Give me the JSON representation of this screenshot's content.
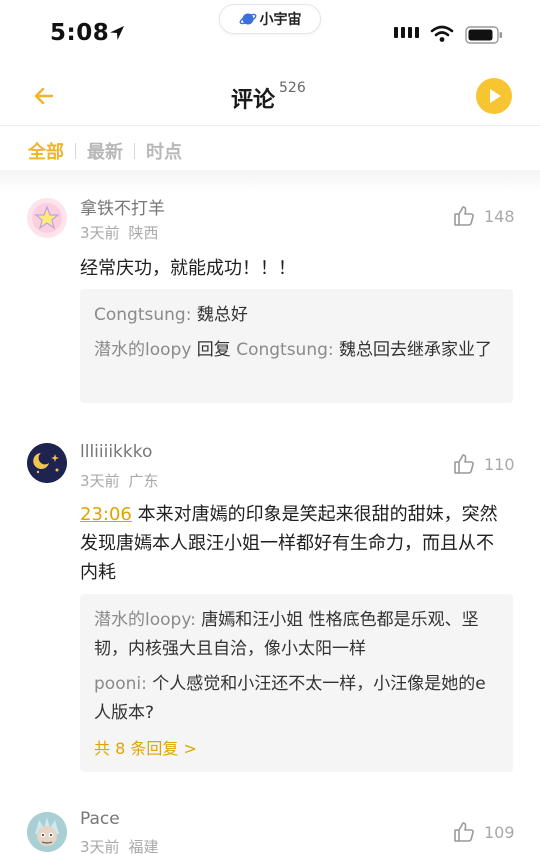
{
  "status": {
    "time": "5:08",
    "app_name": "小宇宙"
  },
  "nav": {
    "title": "评论",
    "count": "526"
  },
  "tabs": [
    {
      "label": "全部",
      "active": true
    },
    {
      "label": "最新",
      "active": false
    },
    {
      "label": "时点",
      "active": false
    }
  ],
  "comments": [
    {
      "user": "拿铁不打羊",
      "time": "3天前",
      "location": "陕西",
      "likes": "148",
      "text": "经常庆功，就能成功！！！",
      "replies": [
        {
          "name": "Congtsung",
          "sep": ": ",
          "text": "魏总好"
        },
        {
          "name": "潜水的loopy",
          "mid": " 回复 ",
          "target": "Congtsung",
          "sep": ": ",
          "text": "魏总回去继承家业了"
        }
      ]
    },
    {
      "user": "llliiiikkko",
      "time": "3天前",
      "location": "广东",
      "likes": "110",
      "timestamp": "23:06",
      "text": " 本来对唐嫣的印象是笑起来很甜的甜妹，突然发现唐嫣本人跟汪小姐一样都好有生命力，而且从不内耗",
      "replies": [
        {
          "name": "潜水的loopy",
          "sep": ": ",
          "text": "唐嫣和汪小姐 性格底色都是乐观、坚韧，内核强大且自洽，像小太阳一样"
        },
        {
          "name": "pooni",
          "sep": ": ",
          "text": "个人感觉和小汪还不太一样，小汪像是她的e人版本?"
        }
      ],
      "more_label": "共 8 条回复 >"
    },
    {
      "user": "Pace",
      "time": "3天前",
      "location": "福建",
      "likes": "109"
    }
  ],
  "colors": {
    "accent": "#f0b429",
    "play": "#f7c531",
    "reply_bg": "#f5f5f5"
  },
  "icons": [
    "location-arrow-icon",
    "planet-icon",
    "signal-icon",
    "wifi-icon",
    "battery-icon",
    "back-arrow-icon",
    "play-icon",
    "thumbs-up-icon"
  ]
}
